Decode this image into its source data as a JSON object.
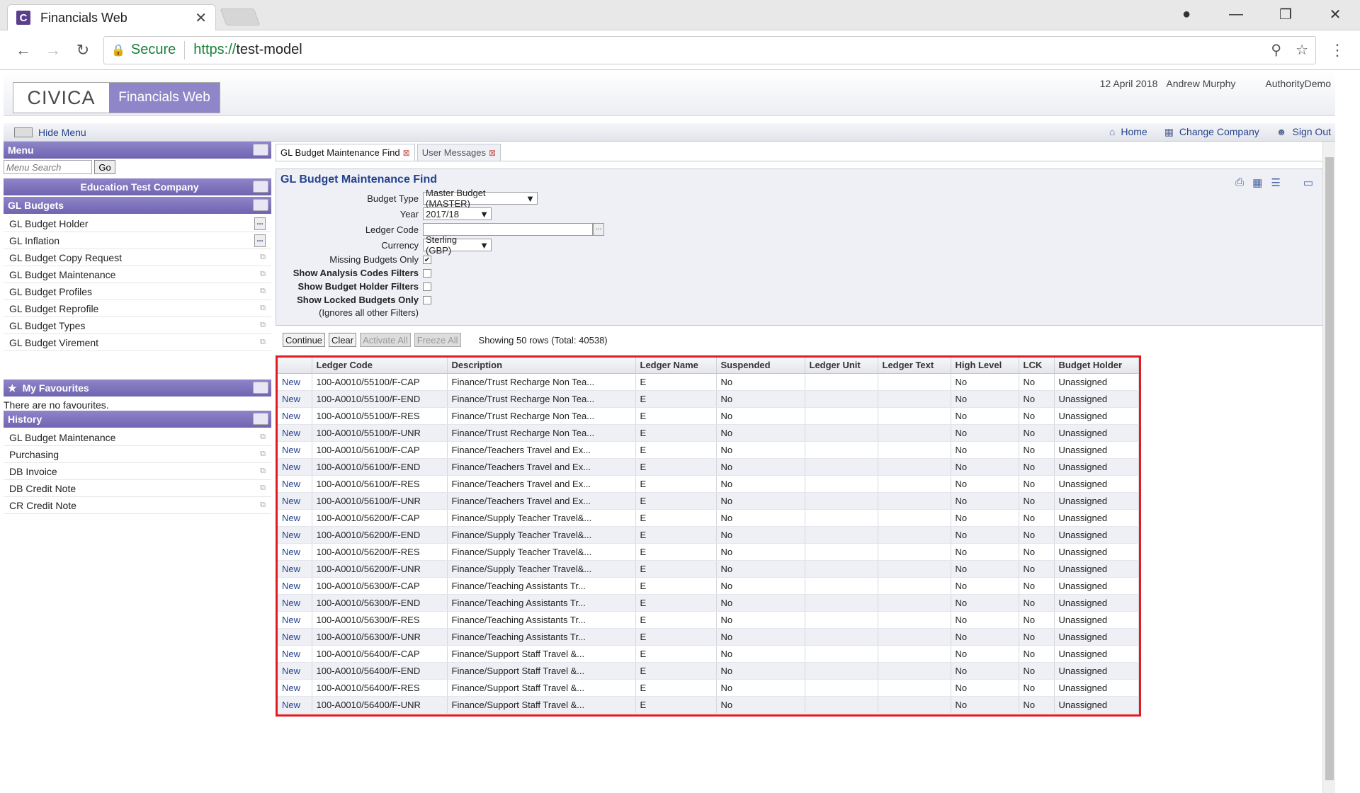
{
  "browser": {
    "tab_title": "Financials Web",
    "favicon": "C",
    "url_protocol": "https://",
    "url_host": "test-model",
    "secure_label": "Secure"
  },
  "header": {
    "logo_left": "CIVICA",
    "logo_right": "Financials Web",
    "date": "12 April 2018",
    "user": "Andrew Murphy",
    "authority": "AuthorityDemo"
  },
  "toolbar": {
    "hide_menu": "Hide Menu",
    "home": "Home",
    "change_company": "Change Company",
    "sign_out": "Sign Out"
  },
  "sidebar": {
    "menu_title": "Menu",
    "search_placeholder": "Menu Search",
    "go": "Go",
    "company": "Education Test Company",
    "section": "GL Budgets",
    "items": [
      "GL Budget Holder",
      "GL Inflation",
      "GL Budget Copy Request",
      "GL Budget Maintenance",
      "GL Budget Profiles",
      "GL Budget Reprofile",
      "GL Budget Types",
      "GL Budget Virement"
    ],
    "fav_title": "My Favourites",
    "no_fav": "There are no favourites.",
    "history_title": "History",
    "history": [
      "GL Budget Maintenance",
      "Purchasing",
      "DB Invoice",
      "DB Credit Note",
      "CR Credit Note"
    ]
  },
  "tabs": [
    {
      "label": "GL Budget Maintenance Find"
    },
    {
      "label": "User Messages"
    }
  ],
  "panel": {
    "title": "GL Budget Maintenance Find",
    "budget_type_label": "Budget Type",
    "budget_type": "Master Budget (MASTER)",
    "year_label": "Year",
    "year": "2017/18",
    "ledger_code_label": "Ledger Code",
    "currency_label": "Currency",
    "currency": "Sterling (GBP)",
    "missing_label": "Missing Budgets Only",
    "analysis_label": "Show Analysis Codes Filters",
    "holder_label": "Show Budget Holder Filters",
    "locked_label": "Show Locked Budgets Only",
    "ignores": "(Ignores all other Filters)"
  },
  "actions": {
    "continue": "Continue",
    "clear": "Clear",
    "activate": "Activate All",
    "freeze": "Freeze All",
    "showing": "Showing 50 rows (Total: 40538)"
  },
  "table": {
    "headers": [
      "",
      "Ledger Code",
      "Description",
      "Ledger Name",
      "Suspended",
      "Ledger Unit",
      "Ledger Text",
      "High Level",
      "LCK",
      "Budget Holder"
    ],
    "rows": [
      [
        "New",
        "100-A0010/55100/F-CAP",
        "Finance/Trust Recharge Non Tea...",
        "E",
        "No",
        "",
        "",
        "No",
        "No",
        "Unassigned"
      ],
      [
        "New",
        "100-A0010/55100/F-END",
        "Finance/Trust Recharge Non Tea...",
        "E",
        "No",
        "",
        "",
        "No",
        "No",
        "Unassigned"
      ],
      [
        "New",
        "100-A0010/55100/F-RES",
        "Finance/Trust Recharge Non Tea...",
        "E",
        "No",
        "",
        "",
        "No",
        "No",
        "Unassigned"
      ],
      [
        "New",
        "100-A0010/55100/F-UNR",
        "Finance/Trust Recharge Non Tea...",
        "E",
        "No",
        "",
        "",
        "No",
        "No",
        "Unassigned"
      ],
      [
        "New",
        "100-A0010/56100/F-CAP",
        "Finance/Teachers Travel and Ex...",
        "E",
        "No",
        "",
        "",
        "No",
        "No",
        "Unassigned"
      ],
      [
        "New",
        "100-A0010/56100/F-END",
        "Finance/Teachers Travel and Ex...",
        "E",
        "No",
        "",
        "",
        "No",
        "No",
        "Unassigned"
      ],
      [
        "New",
        "100-A0010/56100/F-RES",
        "Finance/Teachers Travel and Ex...",
        "E",
        "No",
        "",
        "",
        "No",
        "No",
        "Unassigned"
      ],
      [
        "New",
        "100-A0010/56100/F-UNR",
        "Finance/Teachers Travel and Ex...",
        "E",
        "No",
        "",
        "",
        "No",
        "No",
        "Unassigned"
      ],
      [
        "New",
        "100-A0010/56200/F-CAP",
        "Finance/Supply Teacher Travel&...",
        "E",
        "No",
        "",
        "",
        "No",
        "No",
        "Unassigned"
      ],
      [
        "New",
        "100-A0010/56200/F-END",
        "Finance/Supply Teacher Travel&...",
        "E",
        "No",
        "",
        "",
        "No",
        "No",
        "Unassigned"
      ],
      [
        "New",
        "100-A0010/56200/F-RES",
        "Finance/Supply Teacher Travel&...",
        "E",
        "No",
        "",
        "",
        "No",
        "No",
        "Unassigned"
      ],
      [
        "New",
        "100-A0010/56200/F-UNR",
        "Finance/Supply Teacher Travel&...",
        "E",
        "No",
        "",
        "",
        "No",
        "No",
        "Unassigned"
      ],
      [
        "New",
        "100-A0010/56300/F-CAP",
        "Finance/Teaching Assistants Tr...",
        "E",
        "No",
        "",
        "",
        "No",
        "No",
        "Unassigned"
      ],
      [
        "New",
        "100-A0010/56300/F-END",
        "Finance/Teaching Assistants Tr...",
        "E",
        "No",
        "",
        "",
        "No",
        "No",
        "Unassigned"
      ],
      [
        "New",
        "100-A0010/56300/F-RES",
        "Finance/Teaching Assistants Tr...",
        "E",
        "No",
        "",
        "",
        "No",
        "No",
        "Unassigned"
      ],
      [
        "New",
        "100-A0010/56300/F-UNR",
        "Finance/Teaching Assistants Tr...",
        "E",
        "No",
        "",
        "",
        "No",
        "No",
        "Unassigned"
      ],
      [
        "New",
        "100-A0010/56400/F-CAP",
        "Finance/Support Staff Travel &...",
        "E",
        "No",
        "",
        "",
        "No",
        "No",
        "Unassigned"
      ],
      [
        "New",
        "100-A0010/56400/F-END",
        "Finance/Support Staff Travel &...",
        "E",
        "No",
        "",
        "",
        "No",
        "No",
        "Unassigned"
      ],
      [
        "New",
        "100-A0010/56400/F-RES",
        "Finance/Support Staff Travel &...",
        "E",
        "No",
        "",
        "",
        "No",
        "No",
        "Unassigned"
      ],
      [
        "New",
        "100-A0010/56400/F-UNR",
        "Finance/Support Staff Travel &...",
        "E",
        "No",
        "",
        "",
        "No",
        "No",
        "Unassigned"
      ]
    ]
  }
}
